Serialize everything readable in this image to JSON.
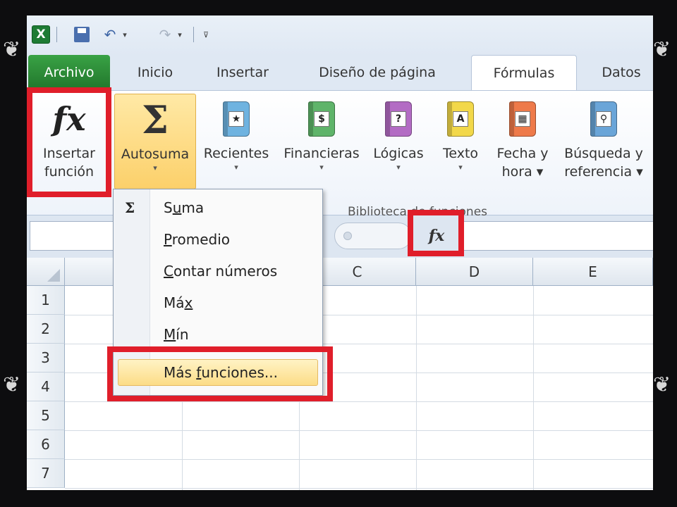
{
  "quick_access": {
    "app_logo": "X",
    "undo_glyph": "↶",
    "redo_glyph": "↷",
    "dropdown_glyph": "▾",
    "customize_glyph": "⊽"
  },
  "tabs": [
    {
      "label": "Archivo"
    },
    {
      "label": "Inicio"
    },
    {
      "label": "Insertar"
    },
    {
      "label": "Diseño de página"
    },
    {
      "label": "Fórmulas"
    },
    {
      "label": "Datos"
    }
  ],
  "ribbon": {
    "insert_function": {
      "line1": "Insertar",
      "line2": "función",
      "icon": "fx"
    },
    "autosuma": {
      "label": "Autosuma",
      "icon": "Σ",
      "caret": "▾"
    },
    "recientes": {
      "label": "Recientes",
      "caret": "▾",
      "plate": "★"
    },
    "financieras": {
      "label": "Financieras",
      "caret": "▾",
      "plate": "$"
    },
    "logicas": {
      "label": "Lógicas",
      "caret": "▾",
      "plate": "?"
    },
    "texto": {
      "label": "Texto",
      "caret": "▾",
      "plate": "A"
    },
    "fecha_hora": {
      "line1": "Fecha y",
      "line2": "hora ▾",
      "plate": "▦"
    },
    "busqueda": {
      "line1": "Búsqueda y",
      "line2": "referencia ▾",
      "plate": "⚲"
    },
    "group_label": "Biblioteca de funciones"
  },
  "formula_bar": {
    "fx_label": "fx"
  },
  "grid": {
    "columns": [
      "C",
      "D",
      "E"
    ],
    "rows": [
      "1",
      "2",
      "3",
      "4",
      "5",
      "6",
      "7"
    ]
  },
  "menu": {
    "icon": "Σ",
    "items": [
      {
        "label_pre": "S",
        "label_u": "u",
        "label_post": "ma"
      },
      {
        "label_pre": "",
        "label_u": "P",
        "label_post": "romedio"
      },
      {
        "label_pre": "",
        "label_u": "C",
        "label_post": "ontar números"
      },
      {
        "label_pre": "Má",
        "label_u": "x",
        "label_post": ""
      },
      {
        "label_pre": "",
        "label_u": "M",
        "label_post": "ín"
      }
    ],
    "more": {
      "label_pre": "Más ",
      "label_u": "f",
      "label_post": "unciones..."
    }
  },
  "colors": {
    "highlight_red": "#e01e2a",
    "archivo_green": "#21762b",
    "pressed_yellow": "#fcd06a"
  },
  "ornaments": [
    "❦",
    "❦",
    "❦",
    "❦"
  ]
}
